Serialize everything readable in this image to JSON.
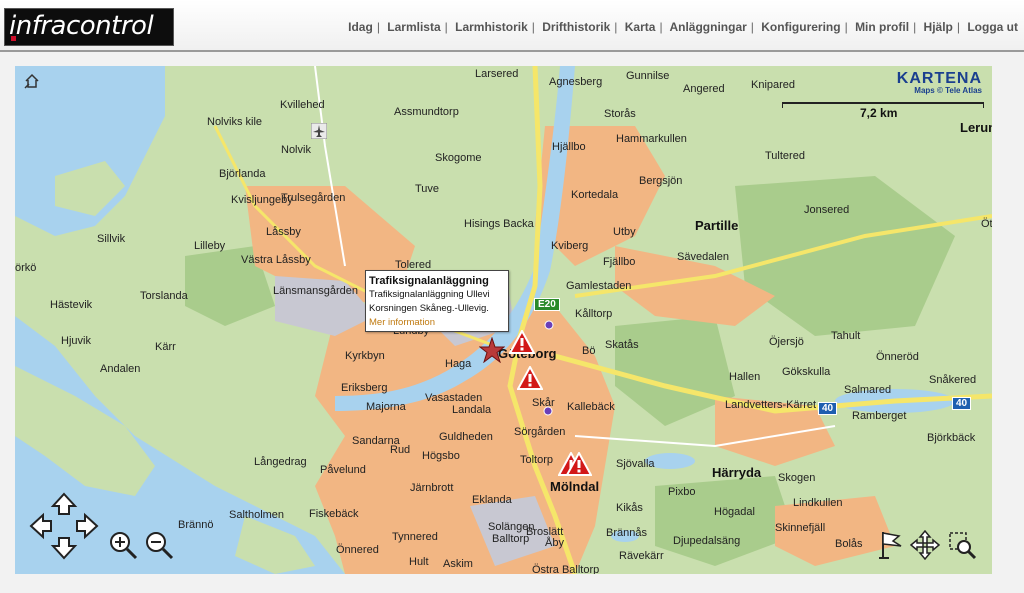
{
  "header": {
    "logo_text": "infracontrol",
    "nav": [
      "Idag",
      "Larmlista",
      "Larmhistorik",
      "Drifthistorik",
      "Karta",
      "Anläggningar",
      "Konfigurering",
      "Min profil",
      "Hjälp",
      "Logga ut"
    ]
  },
  "map": {
    "brand": "KARTENA",
    "brand_sub": "Maps © Tele Atlas",
    "scale_label": "7,2 km",
    "places": {
      "larsered": "Larsered",
      "agnesberg": "Agnesberg",
      "gunnilse": "Gunnilse",
      "angered": "Angered",
      "knipared": "Knipared",
      "lerum": "Lerum",
      "kvillehed": "Kvillehed",
      "assmundtorp": "Assmundtorp",
      "nolviks_kile": "Nolviks kile",
      "nolvik": "Nolvik",
      "storas": "Storås",
      "hjallbo": "Hjällbo",
      "hammarkullen": "Hammarkullen",
      "tultered": "Tultered",
      "skogome": "Skogome",
      "bjorlanda": "Björlanda",
      "kvisljungeby": "Kvisljungeby",
      "trulsegarden": "Trulsegården",
      "tuve": "Tuve",
      "kortedala": "Kortedala",
      "bergsjon": "Bergsjön",
      "jonsered": "Jonsered",
      "sillvik": "Sillvik",
      "lillеby": "Lilleby",
      "lassby": "Låssby",
      "hisings_backa": "Hisings Backa",
      "kviberg": "Kviberg",
      "utby": "Utby",
      "partille": "Partille",
      "vastra_lassby": "Västra Låssby",
      "fjallbo": "Fjällbo",
      "savedalen": "Sävedalen",
      "torko": "örkö",
      "tolered": "Tolered",
      "hastevik": "Hästevik",
      "torslanda": "Torslanda",
      "lansmansgarden": "Länsmansgården",
      "lundby": "Lundby",
      "gamlestaden": "Gamlestaden",
      "kalltorp": "Kålltorp",
      "hjuvik": "Hjuvik",
      "karr": "Kärr",
      "tahult": "Tahult",
      "ojersjo": "Öjersjö",
      "onnered_e": "Önneröd",
      "kyrkbyn": "Kyrkbyn",
      "goteborg": "Göteborg",
      "bo": "Bö",
      "skatas": "Skatås",
      "andalen": "Andalen",
      "haga": "Haga",
      "hallen": "Hallen",
      "gokskulla": "Gökskulla",
      "snakered": "Snåkered",
      "salmared": "Salmared",
      "eriksberg": "Eriksberg",
      "vasastaden": "Vasastaden",
      "kallebäck": "Kallebäck",
      "landvetters_karret": "Landvetters-Kärret",
      "ramberget": "Ramberget",
      "majorna": "Majorna",
      "landala": "Landala",
      "skar": "Skår",
      "sandarna": "Sandarna",
      "guldheden": "Guldheden",
      "sorgarden": "Sörgården",
      "bjorkback": "Björkbäck",
      "rud": "Rud",
      "hogsbo": "Högsbo",
      "langedrag": "Långedrag",
      "pavelund": "Påvelund",
      "toltorp": "Toltorp",
      "sjovalla": "Sjövalla",
      "harryda": "Härryda",
      "skogen": "Skogen",
      "jarnbrott": "Järnbrott",
      "molndal": "Mölndal",
      "pixbo": "Pixbo",
      "lindkullen": "Lindkullen",
      "eklanda": "Eklanda",
      "kikas": "Kikås",
      "hogadal": "Högadal",
      "saltholmen": "Saltholmen",
      "fiskeback": "Fiskebäck",
      "branno": "Brännö",
      "solangen": "Solängen",
      "brannas": "Brännås",
      "skinnefjall": "Skinnefjäll",
      "tynnered": "Tynnered",
      "balltorp": "Balltorp",
      "broslatt": "Broslätt",
      "djupedalsang": "Djupedalsäng",
      "bolas": "Bolås",
      "aby": "Åby",
      "onnered_w": "Önnered",
      "ravekarr": "Rävekärr",
      "hult": "Hult",
      "askim": "Askim",
      "ostra_balltorp": "Östra Balltorp",
      "torp_e": "Öt"
    },
    "roads": {
      "e20": "E20",
      "r40a": "40",
      "r40b": "40"
    },
    "popup": {
      "title": "Trafiksignalanläggning",
      "line1": "Trafiksignalanläggning Ullevi",
      "line2": "Korsningen Skåneg.-Ullevig.",
      "link": "Mer information"
    }
  }
}
